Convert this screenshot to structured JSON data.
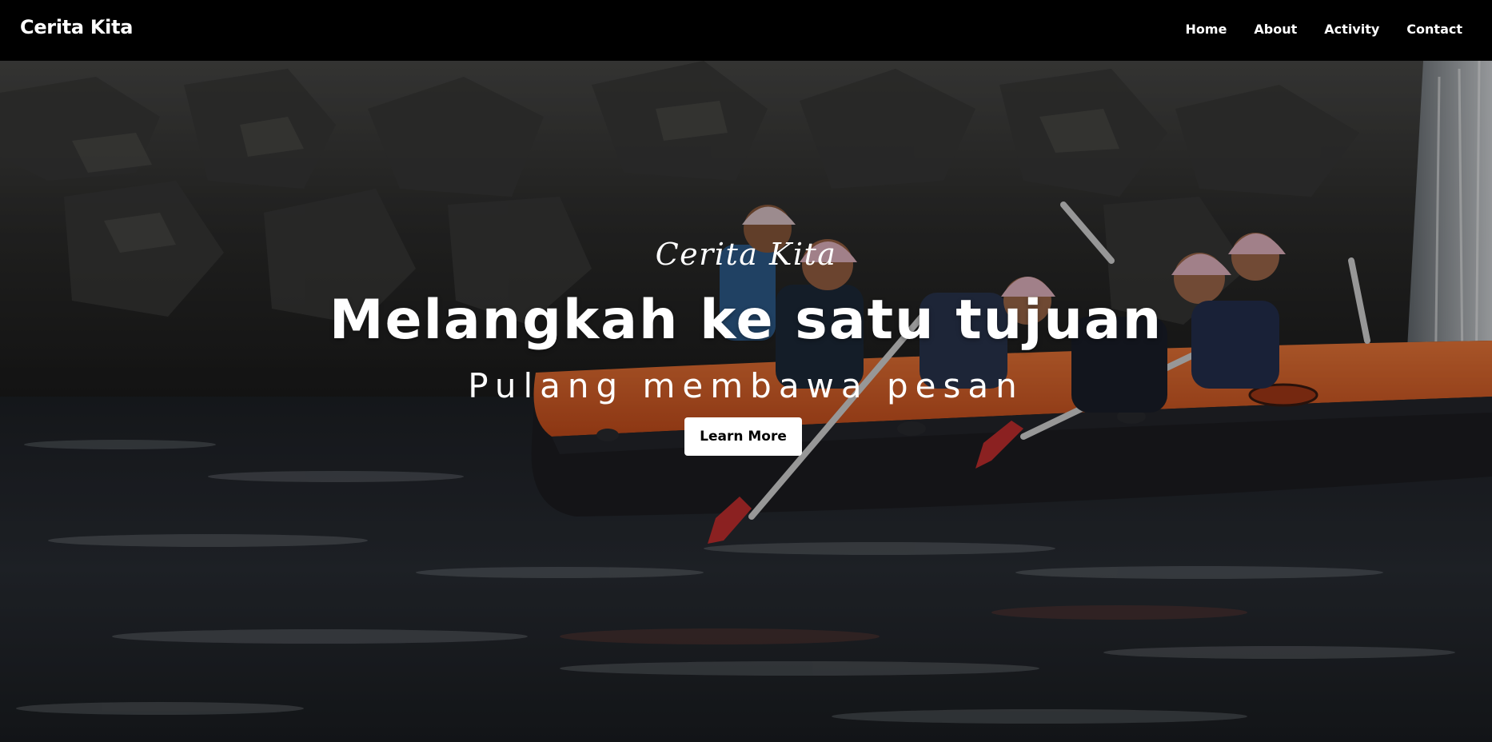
{
  "brand": "Cerita Kita",
  "nav": {
    "home": "Home",
    "about": "About",
    "activity": "Activity",
    "contact": "Contact"
  },
  "hero": {
    "script_title": "Cerita Kita",
    "headline": "Melangkah ke satu tujuan",
    "subline": "Pulang membawa pesan",
    "cta_label": "Learn More",
    "background_image": "river-rafting-photo"
  },
  "colors": {
    "navbar_bg": "#000000",
    "text": "#ffffff",
    "button_bg": "#ffffff",
    "button_text": "#000000",
    "raft": "#e8622a"
  }
}
